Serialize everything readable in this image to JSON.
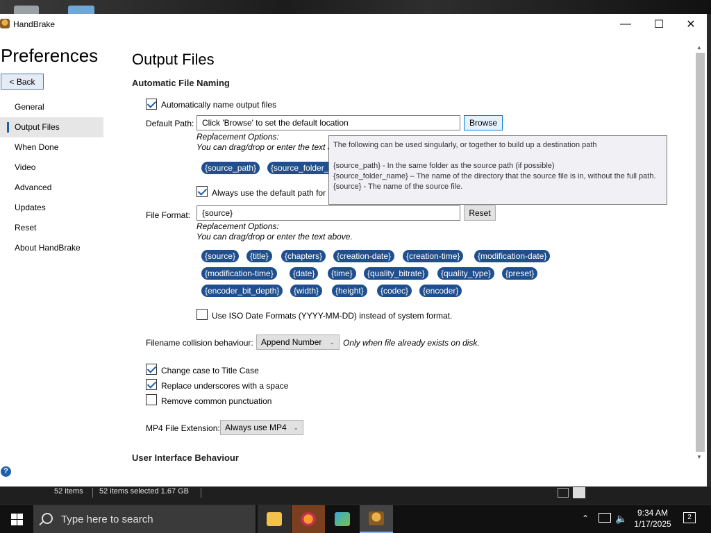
{
  "window": {
    "title": "HandBrake",
    "minimize": "—",
    "maximize": "☐",
    "close": "✕"
  },
  "sidebar": {
    "title": "Preferences",
    "back_label": "< Back",
    "items": [
      {
        "label": "General"
      },
      {
        "label": "Output Files"
      },
      {
        "label": "When Done"
      },
      {
        "label": "Video"
      },
      {
        "label": "Advanced"
      },
      {
        "label": "Updates"
      },
      {
        "label": "Reset"
      },
      {
        "label": "About HandBrake"
      }
    ],
    "active_index": 1,
    "help": "?"
  },
  "main": {
    "title": "Output Files",
    "section_naming": "Automatic File Naming",
    "auto_name_label": "Automatically name output files",
    "default_path_label": "Default Path:",
    "default_path_value": "Click 'Browse' to set the default location",
    "browse_label": "Browse",
    "replacement_title": "Replacement Options:",
    "replacement_hint": "You can drag/drop or enter the text above.",
    "replacement_hint_truncated": "You can drag/drop or enter the text a",
    "path_tags": [
      "{source_path}",
      "{source_folder_n"
    ],
    "always_default_label": "Always use the default path for e",
    "file_format_label": "File Format:",
    "file_format_value": "{source}",
    "reset_label": "Reset",
    "format_tags_row1": [
      "{source}",
      "{title}",
      "{chapters}",
      "{creation-date}",
      "{creation-time}",
      "{modification-date}"
    ],
    "format_tags_row2": [
      "{modification-time}",
      "{date}",
      "{time}",
      "{quality_bitrate}",
      "{quality_type}",
      "{preset}"
    ],
    "format_tags_row3": [
      "{encoder_bit_depth}",
      "{width}",
      "{height}",
      "{codec}",
      "{encoder}"
    ],
    "iso_label": "Use ISO Date Formats (YYYY-MM-DD) instead of system format.",
    "collision_label": "Filename collision behaviour:",
    "collision_value": "Append Number",
    "collision_note": "Only when file already exists on disk.",
    "title_case_label": "Change case to Title Case",
    "underscores_label": "Replace underscores with a space",
    "punctuation_label": "Remove common punctuation",
    "mp4_label": "MP4 File Extension:",
    "mp4_value": "Always use MP4",
    "section_ui": "User Interface Behaviour"
  },
  "tooltip": {
    "line1": "The following can be used singularly, or together to build up a destination path",
    "line2": "{source_path} - In the same folder as the source path (if possible)",
    "line3": "{source_folder_name} – The name of the directory that the source file is in, without the full path.",
    "line4": "{source} - The name of the source file."
  },
  "explorer": {
    "items": "52 items",
    "selected": "52 items selected  1.67 GB"
  },
  "taskbar": {
    "search_placeholder": "Type here to search",
    "time": "9:34 AM",
    "date": "1/17/2025",
    "notifications": "2"
  },
  "colors": {
    "accent": "#1f5fa8",
    "tag_bg": "#1f4f8f"
  }
}
